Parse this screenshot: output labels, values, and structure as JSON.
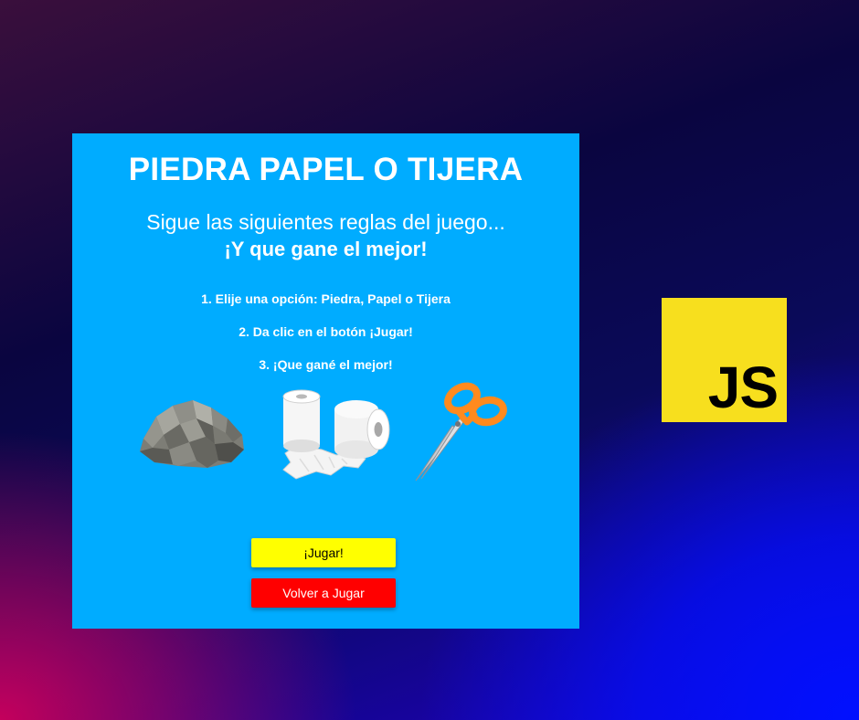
{
  "game": {
    "title": "PIEDRA PAPEL O TIJERA",
    "subtitle": "Sigue las siguientes reglas del juego...",
    "subtitle_strong": "¡Y que gane el mejor!",
    "rules": [
      "1. Elije una opción: Piedra, Papel o Tijera",
      "2. Da clic en el botón ¡Jugar!",
      "3. ¡Que gané el mejor!"
    ],
    "options": [
      {
        "name": "Piedra",
        "icon": "rock-icon"
      },
      {
        "name": "Papel",
        "icon": "toilet-paper-icon"
      },
      {
        "name": "Tijera",
        "icon": "scissors-icon"
      }
    ],
    "play_label": "¡Jugar!",
    "replay_label": "Volver a Jugar"
  },
  "logo": {
    "text": "JS",
    "icon": "javascript-logo-icon"
  },
  "colors": {
    "panel": "#00acff",
    "play_button": "#ffff00",
    "replay_button": "#ff0000",
    "js_logo": "#f7df1e"
  }
}
